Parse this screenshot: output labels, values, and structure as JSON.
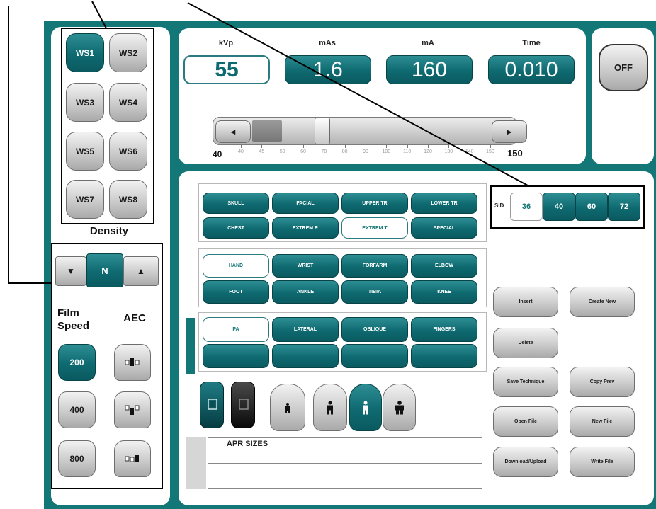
{
  "density_buttons": [
    "WS1",
    "WS2",
    "WS3",
    "WS4",
    "WS5",
    "WS6",
    "WS7",
    "WS8"
  ],
  "density_label": "Density",
  "stepper": {
    "down": "▼",
    "value": "N",
    "up": "▲"
  },
  "film_speed_label_1": "Film",
  "film_speed_label_2": "Speed",
  "aec_label": "AEC",
  "film_speeds": [
    "200",
    "400",
    "800"
  ],
  "exposure": {
    "kvp_label": "kVp",
    "kvp": "55",
    "mas_label": "mAs",
    "mas": "1.6",
    "ma_label": "mA",
    "ma": "160",
    "time_label": "Time",
    "time": "0.010"
  },
  "slider": {
    "min": "40",
    "max": "150",
    "left_arrow": "◂",
    "right_arrow": "▸",
    "ticks": [
      "40",
      "45",
      "50",
      "60",
      "70",
      "80",
      "90",
      "100",
      "110",
      "120",
      "130",
      "140",
      "150"
    ],
    "value": 55
  },
  "off_button": "OFF",
  "body_regions": [
    "SKULL",
    "FACIAL",
    "UPPER TR",
    "LOWER TR",
    "CHEST",
    "EXTREM R",
    "EXTREM T",
    "SPECIAL"
  ],
  "parts": [
    "HAND",
    "WRIST",
    "FORFARM",
    "ELBOW",
    "FOOT",
    "ANKLE",
    "TIBIA",
    "KNEE"
  ],
  "projections": [
    "PA",
    "LATERAL",
    "OBLIQUE",
    "FINGERS",
    "",
    "",
    "",
    ""
  ],
  "sid": {
    "label": "SID",
    "options": [
      "36",
      "40",
      "60",
      "72"
    ]
  },
  "actions": {
    "insert": "Insert",
    "create_new": "Create New",
    "delete": "Delete",
    "save_technique": "Save Technique",
    "copy_prev": "Copy Prev",
    "open_file": "Open File",
    "new_file": "New File",
    "download_upload": "Download/Upload",
    "write_file": "Write File"
  },
  "apr_sizes_label": "APR SIZES"
}
